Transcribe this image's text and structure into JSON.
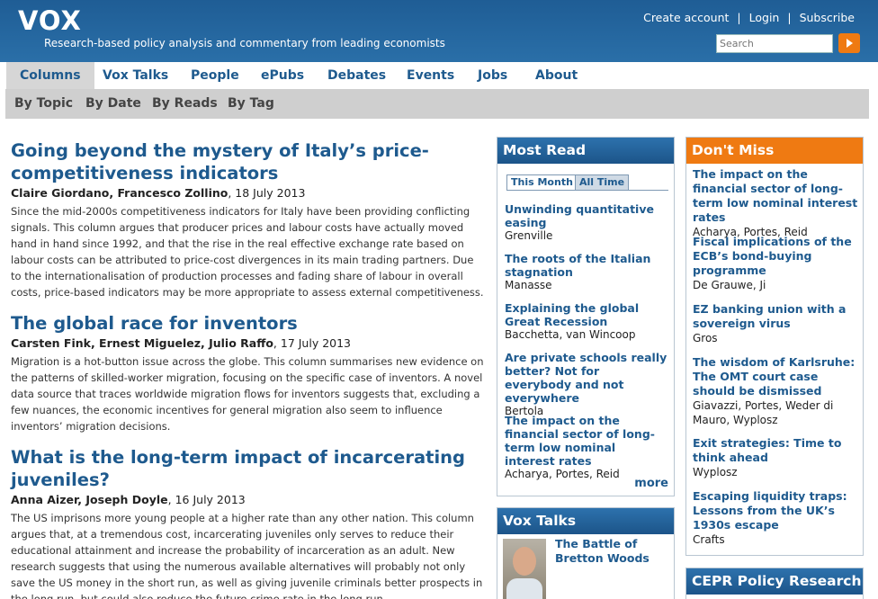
{
  "header": {
    "logo": "VOX",
    "tagline": "Research-based policy analysis and commentary from leading economists",
    "create_account": "Create account",
    "login": "Login",
    "subscribe": "Subscribe",
    "sep": "|",
    "search_placeholder": "Search"
  },
  "nav": [
    "Columns",
    "Vox Talks",
    "People",
    "ePubs",
    "Debates",
    "Events",
    "Jobs",
    "About"
  ],
  "subnav": [
    "By Topic",
    "By Date",
    "By Reads",
    "By Tag"
  ],
  "articles": [
    {
      "title": "Going beyond the mystery of Italy’s price-competitiveness indicators",
      "authors": "Claire Giordano, Francesco Zollino",
      "date": ", 18 July 2013",
      "summary": "Since the mid-2000s competitiveness indicators for Italy have been providing conflicting signals. This column argues that producer prices and labour costs have actually moved hand in hand since 1992, and that the rise in the real effective exchange rate based on labour costs can be attributed to price-cost divergences in its main trading partners. Due to the internationalisation of production processes and fading share of labour in overall costs, price-based indicators may be more appropriate to assess external competitiveness."
    },
    {
      "title": "The global race for inventors",
      "authors": "Carsten Fink, Ernest Miguelez, Julio Raffo",
      "date": ", 17 July 2013",
      "summary": "Migration is a hot-button issue across the globe. This column summarises new evidence on the patterns of skilled-worker migration, focusing on the specific case of inventors. A novel data source that traces worldwide migration flows for inventors suggests that, excluding a few nuances, the economic incentives for general migration also seem to influence inventors’ migration decisions."
    },
    {
      "title": "What is the long-term impact of incarcerating juveniles?",
      "authors": "Anna Aizer, Joseph Doyle",
      "date": ", 16 July 2013",
      "summary": "The US imprisons more young people at a higher rate than any other nation. This column argues that, at a tremendous cost, incarcerating juveniles only serves to reduce their educational attainment and increase the probability of incarceration as an adult. New research suggests that using the numerous available alternatives will probably not only save the US money in the short run, as well as giving juvenile criminals better prospects in the long run, but could also reduce the future crime rate in the long run."
    }
  ],
  "most_read": {
    "title": "Most Read",
    "tabs": [
      "This Month",
      "All Time"
    ],
    "items": [
      {
        "title": "Unwinding quantitative easing",
        "authors": "Grenville"
      },
      {
        "title": "The roots of the Italian stagnation",
        "authors": "Manasse"
      },
      {
        "title": "Explaining the global Great Recession",
        "authors": "Bacchetta, van Wincoop"
      },
      {
        "title": "Are private schools really better? Not for everybody and not everywhere",
        "authors": "Bertola"
      },
      {
        "title": "The impact on the financial sector of long-term low nominal interest rates",
        "authors": "Acharya, Portes, Reid"
      }
    ],
    "more": "more"
  },
  "dont_miss": {
    "title": "Don't Miss",
    "items": [
      {
        "title": "The impact on the financial sector of long-term low nominal interest rates",
        "authors": "Acharya, Portes, Reid"
      },
      {
        "title": "Fiscal implications of the ECB’s bond-buying programme",
        "authors": "De Grauwe, Ji"
      },
      {
        "title": "EZ banking union with a sovereign virus",
        "authors": "Gros"
      },
      {
        "title": "The wisdom of Karlsruhe: The OMT court case should be dismissed",
        "authors": "Giavazzi, Portes, Weder di Mauro, Wyplosz"
      },
      {
        "title": "Exit strategies: Time to think ahead",
        "authors": "Wyplosz"
      },
      {
        "title": "Escaping liquidity traps: Lessons from the UK’s 1930s escape",
        "authors": "Crafts"
      }
    ]
  },
  "vox_talks": {
    "title": "Vox Talks",
    "item_title": "The Battle of Bretton Woods"
  },
  "cepr": {
    "title": "CEPR Policy Research"
  }
}
